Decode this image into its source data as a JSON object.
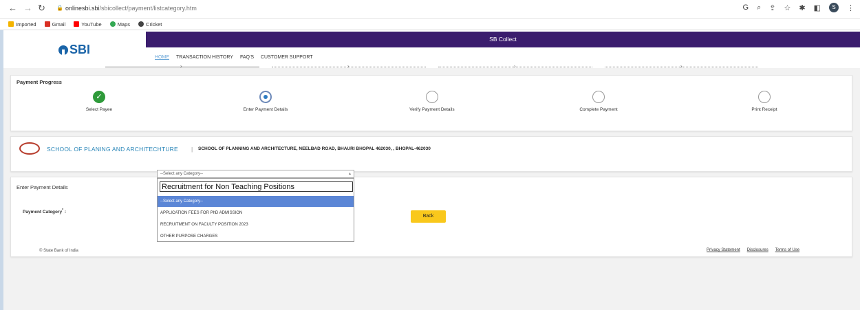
{
  "browser": {
    "url_domain": "onlinesbi.sbi",
    "url_path": "/sbicollect/payment/listcategory.htm",
    "profile_initial": "S",
    "bookmarks": [
      "Imported",
      "Gmail",
      "YouTube",
      "Maps",
      "Cricket"
    ]
  },
  "header": {
    "logo_text": "SBI",
    "banner_title": "SB Collect",
    "nav": [
      "HOME",
      "TRANSACTION HISTORY",
      "FAQ'S",
      "CUSTOMER SUPPORT"
    ]
  },
  "progress": {
    "title": "Payment Progress",
    "steps": [
      "Select Payee",
      "Enter Payment Details",
      "Verify Payment Details",
      "Complete Payment",
      "Print Receipt"
    ]
  },
  "institution": {
    "name": "SCHOOL OF PLANING AND ARCHITECHTURE",
    "separator": "|",
    "address": "SCHOOL OF PLANNING AND ARCHITECTURE, NEELBAD ROAD, BHAURI BHOPAL 462030, , BHOPAL-462030"
  },
  "payment": {
    "title": "Enter Payment Details",
    "category_label": "Payment Category",
    "required_mark": "*",
    "label_colon": ":",
    "select_value": "--Select any Category--",
    "search_text": "Recruitment for Non Teaching Positions",
    "options": [
      "--Select any Category--",
      "APPLICATION FEES FOR PhD ADMISSION",
      "RECRUITMENT ON FACULTY POSITION 2023",
      "OTHER PURPOSE CHARGES"
    ],
    "back_label": "Back"
  },
  "footer": {
    "copyright": "© State Bank of India",
    "links": [
      "Privacy Statement",
      "Disclosures",
      "Terms of Use"
    ]
  },
  "colors": {
    "brand_purple": "#3b1d6e",
    "sbi_blue": "#1a64a8",
    "button_yellow": "#f9c81c",
    "step_done": "#2e9a3a"
  }
}
